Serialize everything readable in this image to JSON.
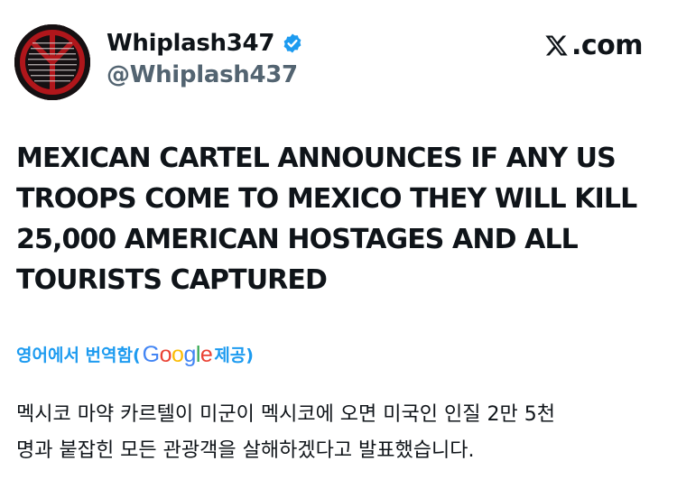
{
  "user": {
    "display_name": "Whiplash347",
    "handle": "@Whiplash437",
    "verified": true,
    "avatar_icon": "red-inverted-peace-sign-on-black"
  },
  "site": {
    "logo_icon": "x-logo",
    "domain_suffix": ".com"
  },
  "tweet": {
    "lines": [
      "MEXICAN CARTEL ANNOUNCES IF ANY US",
      "TROOPS COME TO MEXICO THEY WILL KILL",
      "25,000 AMERICAN HOSTAGES AND ALL",
      "TOURISTS CAPTURED"
    ]
  },
  "translation": {
    "prefix": "영어에서 번역함(",
    "provider": "Google",
    "provider_colors": [
      "#4285F4",
      "#EA4335",
      "#FBBC05",
      "#4285F4",
      "#34A853",
      "#EA4335"
    ],
    "suffix": " 제공)",
    "lines": [
      "멕시코 마약 카르텔이 미군이 멕시코에 오면 미국인 인질 2만 5천",
      "명과 붙잡힌 모든 관광객을 살해하겠다고 발표했습니다."
    ]
  },
  "colors": {
    "accent": "#1d9bf0",
    "text": "#0f1419",
    "muted": "#536471"
  }
}
